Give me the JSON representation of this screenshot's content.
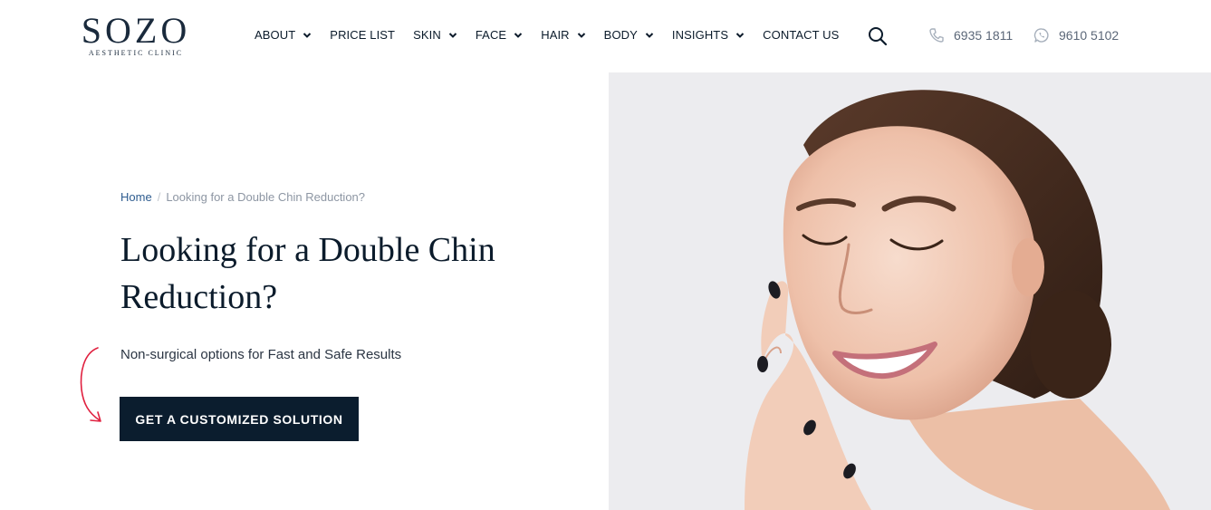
{
  "brand": {
    "name": "SOZO",
    "tagline": "AESTHETIC CLINIC"
  },
  "nav": {
    "items": [
      {
        "label": "ABOUT",
        "dropdown": true
      },
      {
        "label": "PRICE LIST",
        "dropdown": false
      },
      {
        "label": "SKIN",
        "dropdown": true
      },
      {
        "label": "FACE",
        "dropdown": true
      },
      {
        "label": "HAIR",
        "dropdown": true
      },
      {
        "label": "BODY",
        "dropdown": true
      },
      {
        "label": "INSIGHTS",
        "dropdown": true
      },
      {
        "label": "CONTACT US",
        "dropdown": false
      }
    ]
  },
  "contacts": {
    "phone": "6935 1811",
    "whatsapp": "9610 5102"
  },
  "breadcrumb": {
    "home": "Home",
    "separator": "/",
    "current": "Looking for a Double Chin Reduction?"
  },
  "hero": {
    "title": "Looking for a Double Chin Reduction?",
    "subtitle": "Non-surgical options for Fast and Safe Results",
    "cta_label": "GET A CUSTOMIZED SOLUTION"
  },
  "colors": {
    "primary_dark": "#0b1d2e",
    "link_blue": "#2e5c8f",
    "arrow_accent": "#e0203f",
    "photo_bg": "#ececef"
  }
}
